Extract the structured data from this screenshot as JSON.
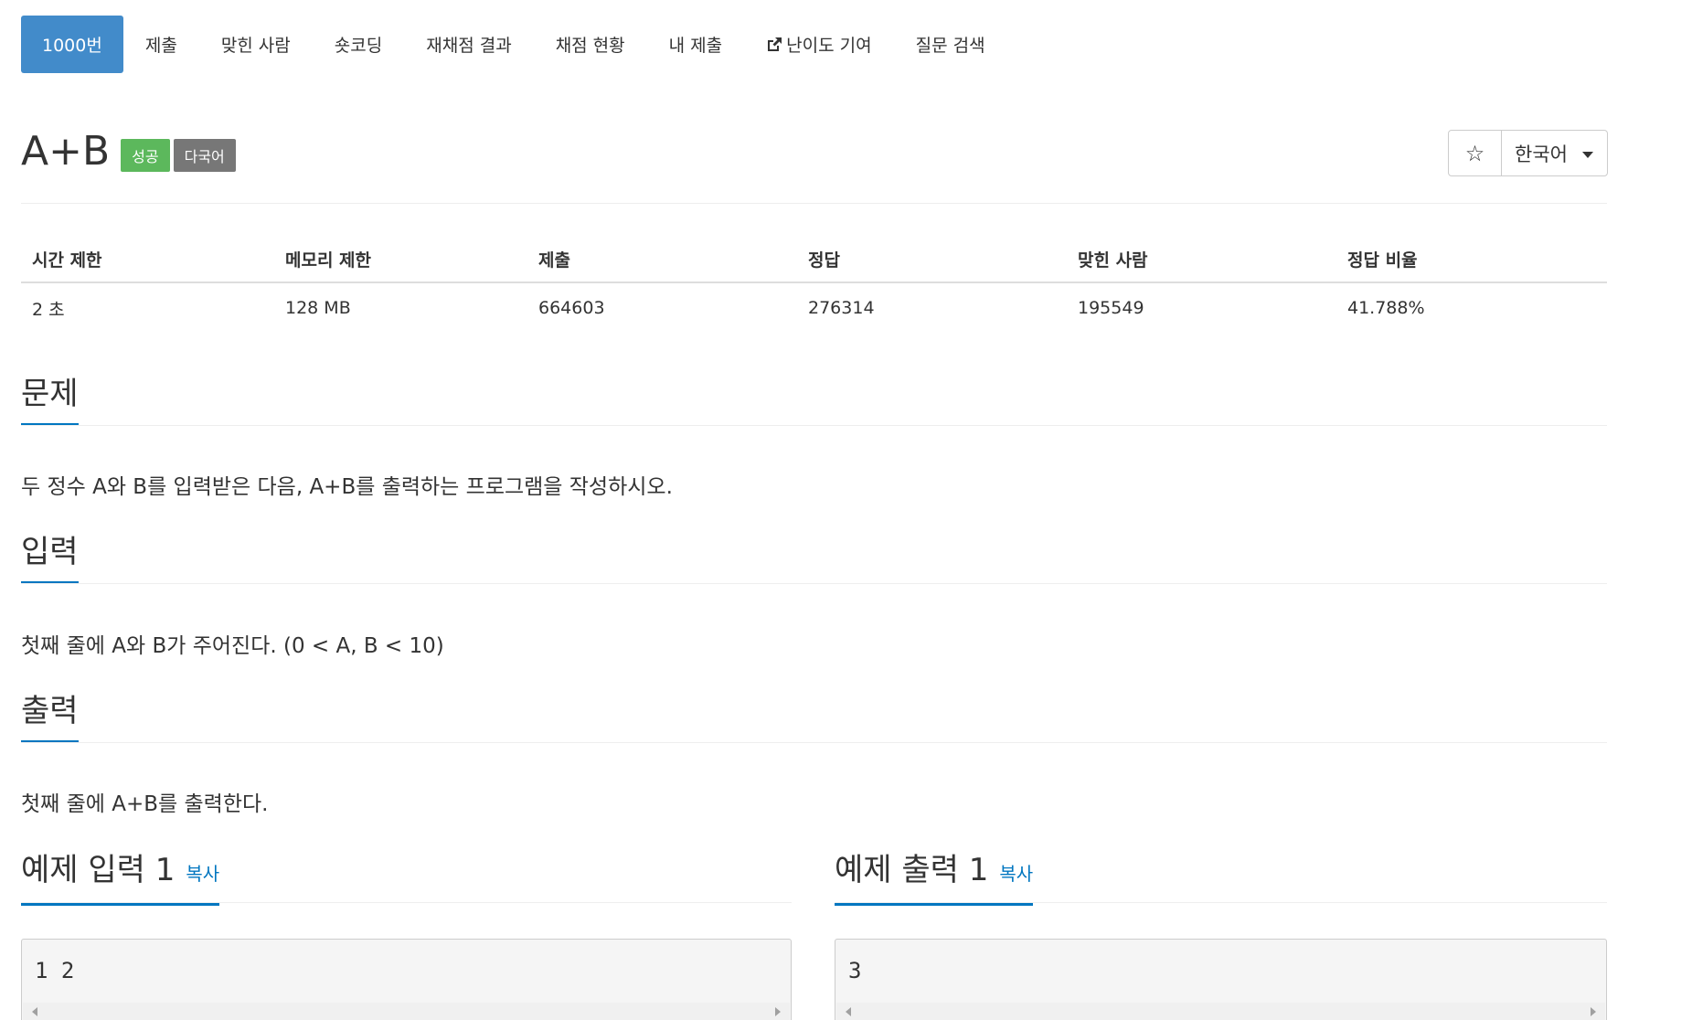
{
  "nav": {
    "items": [
      {
        "label": "1000번",
        "active": true
      },
      {
        "label": "제출"
      },
      {
        "label": "맞힌 사람"
      },
      {
        "label": "숏코딩"
      },
      {
        "label": "재채점 결과"
      },
      {
        "label": "채점 현황"
      },
      {
        "label": "내 제출"
      },
      {
        "label": "난이도 기여",
        "icon": "external-link-icon"
      },
      {
        "label": "질문 검색"
      }
    ]
  },
  "problem": {
    "title": "A+B",
    "labels": {
      "status": "성공",
      "multilang": "다국어"
    },
    "star_icon": "☆",
    "language": "한국어"
  },
  "info": {
    "headers": [
      "시간 제한",
      "메모리 제한",
      "제출",
      "정답",
      "맞힌 사람",
      "정답 비율"
    ],
    "values": [
      "2 초",
      "128 MB",
      "664603",
      "276314",
      "195549",
      "41.788%"
    ]
  },
  "sections": {
    "problem": {
      "title": "문제",
      "text": "두 정수 A와 B를 입력받은 다음, A+B를 출력하는 프로그램을 작성하시오."
    },
    "input": {
      "title": "입력",
      "text": "첫째 줄에 A와 B가 주어진다. (0 < A, B < 10)"
    },
    "output": {
      "title": "출력",
      "text": "첫째 줄에 A+B를 출력한다."
    }
  },
  "samples": {
    "input": {
      "title": "예제 입력 1",
      "copy": "복사",
      "content": "1 2"
    },
    "output": {
      "title": "예제 출력 1",
      "copy": "복사",
      "content": "3"
    }
  },
  "colors": {
    "primary": "#428bca",
    "success": "#5cb85c",
    "multilang": "#777777",
    "accent_line": "#0076c0"
  }
}
